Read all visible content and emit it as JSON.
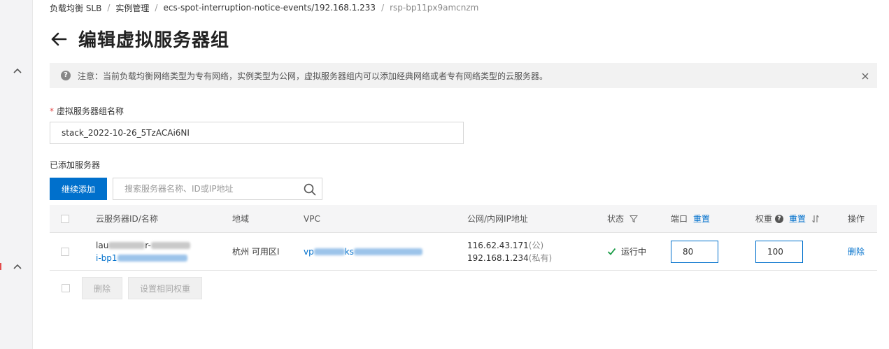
{
  "breadcrumb": [
    {
      "label": "负载均衡 SLB"
    },
    {
      "label": "实例管理"
    },
    {
      "label": "ecs-spot-interruption-notice-events/192.168.1.233"
    },
    {
      "label": "rsp-bp11px9amcnzm"
    }
  ],
  "breadcrumb_separator": "/",
  "page": {
    "title": "编辑虚拟服务器组"
  },
  "notice": {
    "text": "注意：当前负载均衡网络类型为专有网络，实例类型为公网，虚拟服务器组内可以添加经典网络或者专有网络类型的云服务器。",
    "help_glyph": "?"
  },
  "form": {
    "required_mark": "*",
    "group_name_label": "虚拟服务器组名称",
    "group_name_value": "stack_2022-10-26_5TzACAi6NI"
  },
  "servers_section": {
    "label": "已添加服务器",
    "add_button": "继续添加",
    "search_placeholder": "搜索服务器名称、ID或IP地址"
  },
  "table": {
    "columns": {
      "server": "云服务器ID/名称",
      "region": "地域",
      "vpc": "VPC",
      "ip": "公网/内网IP地址",
      "status": "状态",
      "port": "端口",
      "port_reset": "重置",
      "weight": "权重",
      "weight_reset": "重置",
      "weight_help": "?",
      "action": "操作"
    },
    "rows": [
      {
        "name_visible_start": "lau",
        "name_visible_mid": "r-",
        "id_visible_start": "i-bp1",
        "region": "杭州 可用区I",
        "vpc_visible_start": "vp",
        "vpc_visible_mid": "ks",
        "public_ip": "116.62.43.171",
        "public_tag": "(公)",
        "private_ip": "192.168.1.234",
        "private_tag": "(私有)",
        "status": "运行中",
        "port": "80",
        "weight": "100",
        "delete": "删除"
      }
    ]
  },
  "footer": {
    "delete_button": "删除",
    "same_weight_button": "设置相同权重"
  },
  "colors": {
    "primary": "#0070cc",
    "success": "#1e9e4a",
    "required": "#e34b4b"
  }
}
